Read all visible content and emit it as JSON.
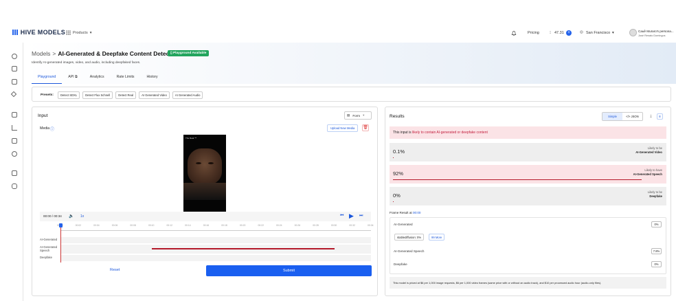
{
  "nav": {
    "logo": "HIVE MODELS",
    "products": "Products",
    "pricing": "Pricing",
    "credits": "47.31",
    "credits_add": "+",
    "region": "San Francisco",
    "user_name": "Cauê Muraro's persona...",
    "user_sub": "José Renato Domingos"
  },
  "header": {
    "crumb_root": "Models",
    "crumb_sep": ">",
    "title": "AI-Generated & Deepfake Content Detection",
    "badge": "Playground Available",
    "description": "Identify AI-generated images, video, and audio, including deepfaked faces.",
    "tabs": [
      "Playground",
      "API",
      "Analytics",
      "Rate Limits",
      "History"
    ]
  },
  "presets": {
    "label": "Presets:",
    "items": [
      "Detect SDXL",
      "Detect Flux Schnell",
      "Detect Real",
      "AI Generated Video",
      "AI Generated Audio"
    ]
  },
  "input": {
    "title": "Input",
    "form_label": "Form",
    "media_label": "Media",
    "upload_label": "Upload New Media",
    "time": "00:00 / 00:34",
    "speed": "1x",
    "ticks": [
      "00:00",
      "00:02",
      "00:04",
      "00:06",
      "00:08",
      "00:10",
      "00:12",
      "00:14",
      "00:16",
      "00:18",
      "00:20",
      "00:22",
      "00:24",
      "00:26",
      "00:28",
      "00:30",
      "00:32",
      "00:34"
    ],
    "tracks": [
      {
        "label": "AI-Generated",
        "segment": null
      },
      {
        "label": "AI-Generated Speech",
        "segment": [
          10,
          30
        ]
      },
      {
        "label": "Deepfake",
        "segment": null
      }
    ],
    "duration": 34,
    "video_caption": "The Real ™",
    "reset_label": "Reset",
    "submit_label": "Submit"
  },
  "results": {
    "title": "Results",
    "toggle": [
      "Simple",
      "</> JSON"
    ],
    "alert_prefix": "This input is",
    "alert_highlight": "likely to contain AI-generated or deepfake content",
    "scores": [
      {
        "pct": "0.1%",
        "value": 0.001,
        "cap_top": "Likely to be",
        "cap_bottom": "AI-Generated Video",
        "highlight": false
      },
      {
        "pct": "92%",
        "value": 0.92,
        "cap_top": "Likely to have",
        "cap_bottom": "AI-Generated Speech",
        "highlight": true
      },
      {
        "pct": "0%",
        "value": 0.0,
        "cap_top": "Likely to be",
        "cap_bottom": "Deepfake",
        "highlight": false
      }
    ],
    "frame_label": "Frame Result at",
    "frame_time": "00:00",
    "frame_items": [
      {
        "label": "AI-Generated",
        "value": "0%"
      },
      {
        "label": "AI-Generated Speech",
        "value": "7.8%"
      },
      {
        "label": "Deepfake",
        "value": "0%"
      }
    ],
    "chip1": "stablediffusion: 0%",
    "chip2": "99 More",
    "note": "This model is priced at $6 per 1,000 image requests, $6 per 1,000 video frames (same price with or without an audio track), and $10 per processed audio hour (audio-only files)."
  },
  "colors": {
    "accent": "#1a56db",
    "danger": "#b41829",
    "success": "#22a45d"
  }
}
